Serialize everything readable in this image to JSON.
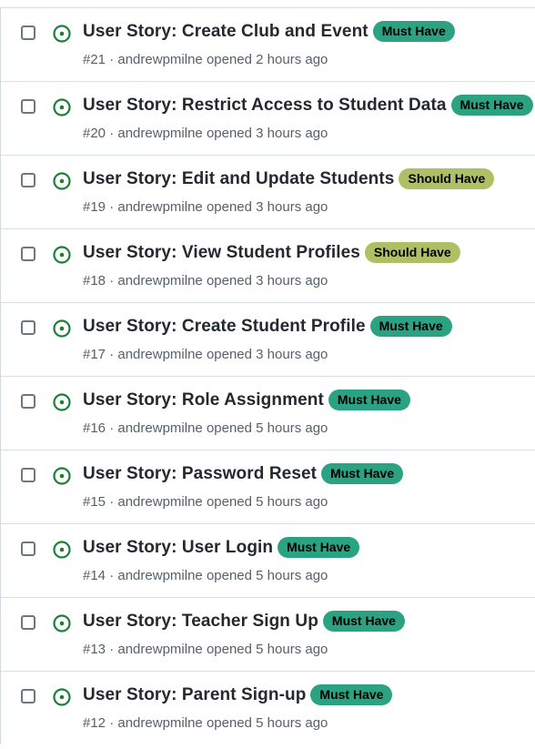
{
  "colors": {
    "open_icon": "#1a7f37",
    "must_have": "#2ba282",
    "should_have": "#aec065"
  },
  "issues": [
    {
      "title": "User Story: Create Club and Event",
      "label": "Must Have",
      "label_type": "must_have",
      "number": "#21",
      "author": "andrewpmilne",
      "opened": "opened 2 hours ago"
    },
    {
      "title": "User Story: Restrict Access to Student Data",
      "label": "Must Have",
      "label_type": "must_have",
      "number": "#20",
      "author": "andrewpmilne",
      "opened": "opened 3 hours ago"
    },
    {
      "title": "User Story: Edit and Update Students",
      "label": "Should Have",
      "label_type": "should_have",
      "number": "#19",
      "author": "andrewpmilne",
      "opened": "opened 3 hours ago"
    },
    {
      "title": "User Story: View Student Profiles",
      "label": "Should Have",
      "label_type": "should_have",
      "number": "#18",
      "author": "andrewpmilne",
      "opened": "opened 3 hours ago"
    },
    {
      "title": "User Story: Create Student Profile",
      "label": "Must Have",
      "label_type": "must_have",
      "number": "#17",
      "author": "andrewpmilne",
      "opened": "opened 3 hours ago"
    },
    {
      "title": "User Story: Role Assignment",
      "label": "Must Have",
      "label_type": "must_have",
      "number": "#16",
      "author": "andrewpmilne",
      "opened": "opened 5 hours ago"
    },
    {
      "title": "User Story: Password Reset",
      "label": "Must Have",
      "label_type": "must_have",
      "number": "#15",
      "author": "andrewpmilne",
      "opened": "opened 5 hours ago"
    },
    {
      "title": "User Story: User Login",
      "label": "Must Have",
      "label_type": "must_have",
      "number": "#14",
      "author": "andrewpmilne",
      "opened": "opened 5 hours ago"
    },
    {
      "title": "User Story: Teacher Sign Up",
      "label": "Must Have",
      "label_type": "must_have",
      "number": "#13",
      "author": "andrewpmilne",
      "opened": "opened 5 hours ago"
    },
    {
      "title": "User Story: Parent Sign-up",
      "label": "Must Have",
      "label_type": "must_have",
      "number": "#12",
      "author": "andrewpmilne",
      "opened": "opened 5 hours ago"
    }
  ]
}
